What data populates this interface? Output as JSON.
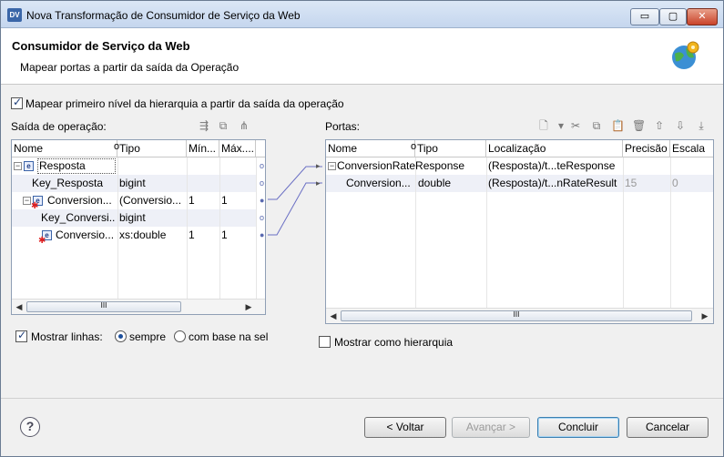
{
  "window": {
    "title": "Nova Transformação de Consumidor de Serviço da Web",
    "app_icon_text": "DV",
    "buttons": {
      "minimize": "▭",
      "maximize": "▢",
      "close": "✕"
    }
  },
  "header": {
    "title": "Consumidor de Serviço da Web",
    "subtitle": "Mapear portas a partir da saída da Operação"
  },
  "map_first_level": {
    "label": "Mapear primeiro nível da hierarquia a partir da saída da operação",
    "checked": true
  },
  "left_panel": {
    "title": "Saída de operação:",
    "columns": [
      "Nome",
      "Tipo",
      "Mín...",
      "Máx...."
    ],
    "rows": [
      {
        "name": "Resposta",
        "type": "",
        "min": "",
        "max": ""
      },
      {
        "name": "Key_Resposta",
        "type": "bigint",
        "min": "",
        "max": ""
      },
      {
        "name": "Conversion...",
        "type": "(Conversio...",
        "min": "1",
        "max": "1"
      },
      {
        "name": "Key_Conversi...",
        "type": "bigint",
        "min": "",
        "max": ""
      },
      {
        "name": "Conversio...",
        "type": "xs:double",
        "min": "1",
        "max": "1"
      }
    ],
    "scroll_grip": "III"
  },
  "right_panel": {
    "title": "Portas:",
    "columns": [
      "Nome",
      "Tipo",
      "Localização",
      "Precisão",
      "Escala"
    ],
    "rows": [
      {
        "name": "ConversionRateResponse",
        "type": "",
        "location": "(Resposta)/t...teResponse",
        "precision": "",
        "scale": ""
      },
      {
        "name": "Conversion...",
        "type": "double",
        "location": "(Resposta)/t...nRateResult",
        "precision": "15",
        "scale": "0"
      }
    ],
    "scroll_grip": "III"
  },
  "show_lines": {
    "label": "Mostrar linhas:",
    "checked": true,
    "options": [
      {
        "label": "sempre",
        "selected": true
      },
      {
        "label": "com base na sel",
        "selected": false
      }
    ]
  },
  "show_hierarchy": {
    "label": "Mostrar como hierarquia",
    "checked": false
  },
  "footer": {
    "help": "?",
    "back": "< Voltar",
    "next": "Avançar >",
    "finish": "Concluir",
    "cancel": "Cancelar"
  }
}
